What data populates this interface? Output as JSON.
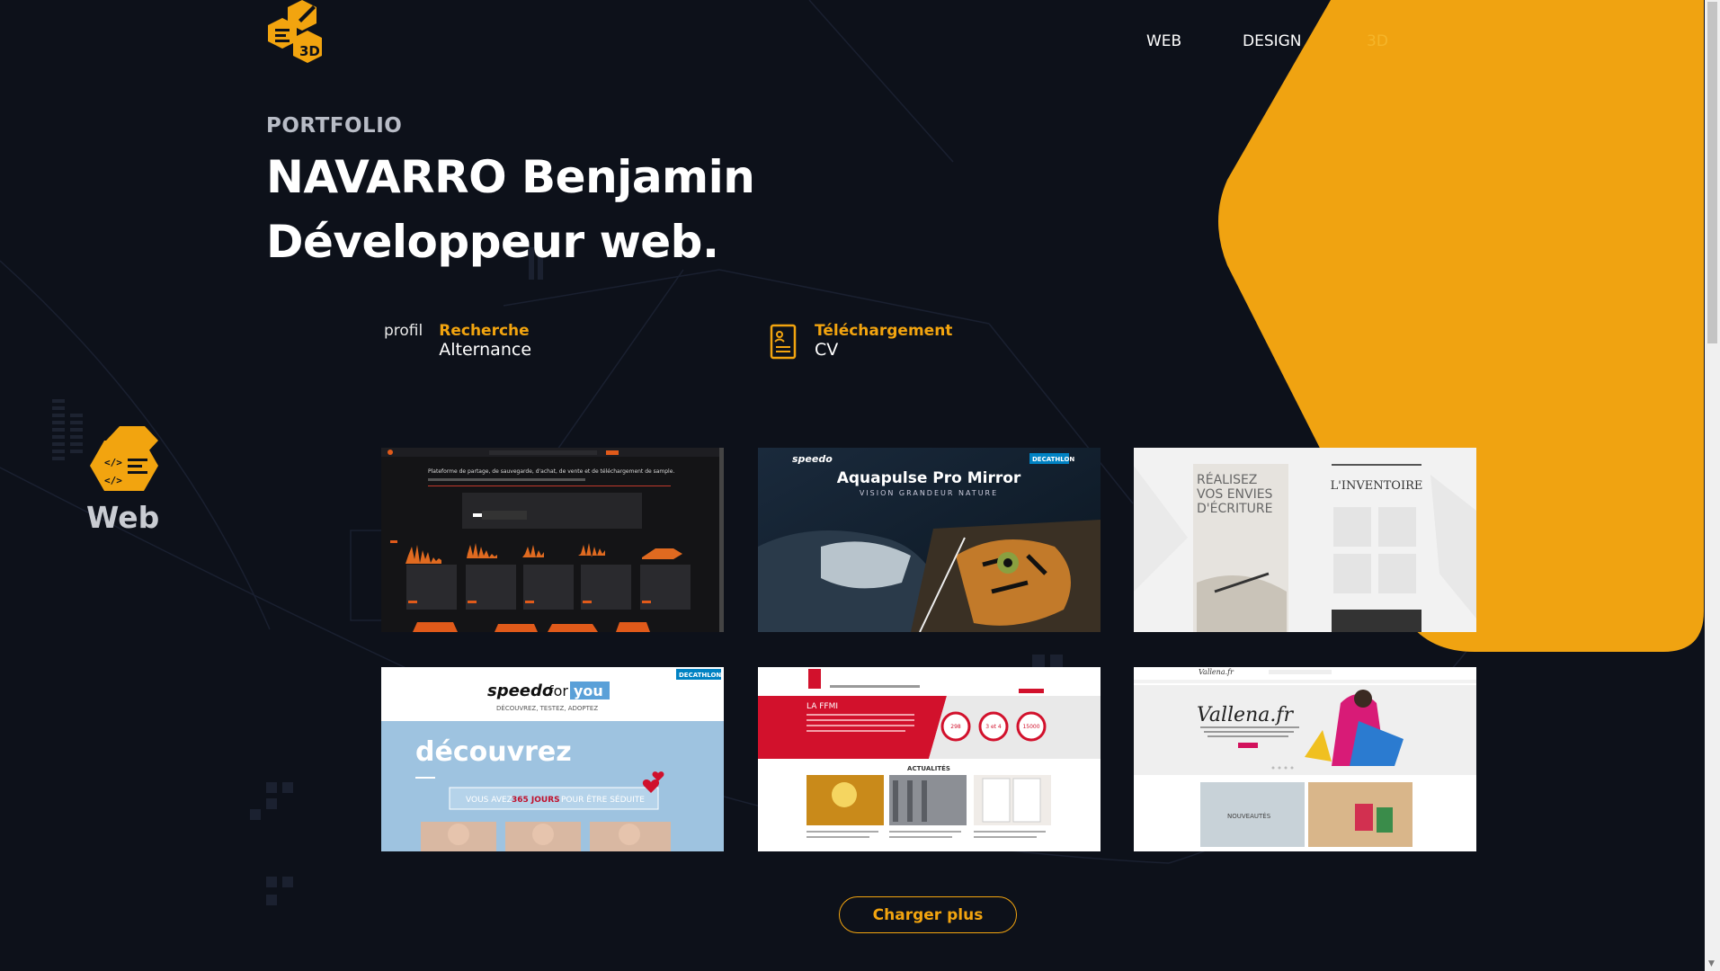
{
  "nav": {
    "items": [
      "WEB",
      "DESIGN",
      "3D"
    ]
  },
  "logo": {
    "letters": "3D"
  },
  "hero": {
    "eyebrow": "PORTFOLIO",
    "name": "NAVARRO Benjamin",
    "role": "Développeur web."
  },
  "cta_search": {
    "prefix": "profil",
    "title": "Recherche",
    "subtitle": "Alternance"
  },
  "cta_cv": {
    "title": "Téléchargement",
    "subtitle": "CV"
  },
  "section": {
    "label": "Web"
  },
  "projects": [
    {
      "caption": "Plateforme de partage, de sauvegarde, d'achat, de vente et de téléchargement de sample."
    },
    {
      "brand": "speedo",
      "partner": "DECATHLON",
      "title": "Aquapulse Pro Mirror",
      "subtitle": "VISION GRANDEUR NATURE"
    },
    {
      "title_line1": "RÉALISEZ",
      "title_line2": "VOS ENVIES",
      "title_line3": "D'ÉCRITURE",
      "right_title": "L'INVENTOIRE"
    },
    {
      "brand": "speedo",
      "tagline": "DÉCOUVREZ, TESTEZ, ADOPTEZ",
      "partner": "DECATHLON",
      "headline": "découvrez",
      "banner_pre": "VOUS AVEZ",
      "banner_mid": "365 JOURS",
      "banner_post": "POUR ÊTRE SÉDUITE"
    },
    {
      "label": "LA FFMI",
      "news": "ACTUALITÉS",
      "stats": [
        "298",
        "3 et 4",
        "15000"
      ]
    },
    {
      "logo": "Vallena.fr",
      "hero": "Vallena.fr",
      "tile": "NOUVEAUTÉS"
    }
  ],
  "load_more": "Charger plus",
  "colors": {
    "accent": "#f2a40f",
    "background": "#0d111a"
  }
}
